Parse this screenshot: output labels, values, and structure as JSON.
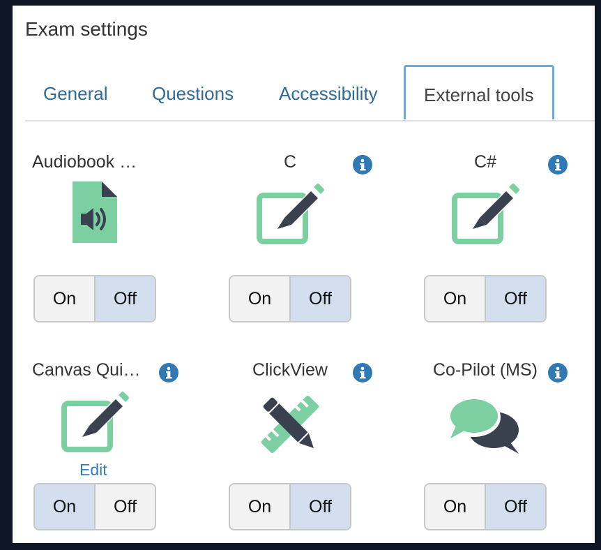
{
  "page_title": "Exam settings",
  "tabs": [
    {
      "label": "General"
    },
    {
      "label": "Questions"
    },
    {
      "label": "Accessibility"
    },
    {
      "label": "External tools",
      "active": true
    }
  ],
  "tools": [
    {
      "name": "Audiobook …",
      "icon": "audio-file-icon",
      "toggle": {
        "on": "On",
        "off": "Off",
        "selected": "off"
      }
    },
    {
      "name": "C",
      "icon": "edit-square-icon",
      "info": true,
      "toggle": {
        "on": "On",
        "off": "Off",
        "selected": "off"
      }
    },
    {
      "name": "C#",
      "icon": "edit-square-icon",
      "info": true,
      "toggle": {
        "on": "On",
        "off": "Off",
        "selected": "off"
      }
    },
    {
      "name": "Canvas Qui…",
      "icon": "edit-square-icon",
      "info": true,
      "edit_label": "Edit",
      "toggle": {
        "on": "On",
        "off": "Off",
        "selected": "on"
      }
    },
    {
      "name": "ClickView",
      "icon": "pencil-ruler-icon",
      "info": true,
      "toggle": {
        "on": "On",
        "off": "Off",
        "selected": "off"
      }
    },
    {
      "name": "Co-Pilot (MS)",
      "icon": "chat-bubbles-icon",
      "info": true,
      "toggle": {
        "on": "On",
        "off": "Off",
        "selected": "off"
      }
    }
  ],
  "colors": {
    "accent": "#2e6b96",
    "icon_green": "#7ccfa0",
    "icon_dark": "#38414d",
    "info_blue": "#2f79b4",
    "selected_toggle": "#d3deef"
  }
}
